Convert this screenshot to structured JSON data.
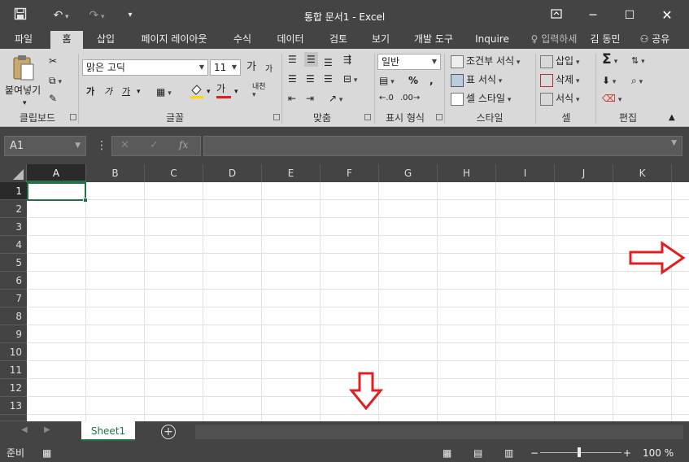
{
  "window": {
    "title": "통합 문서1 - Excel"
  },
  "ribbon_tabs": [
    "파일",
    "홈",
    "삽입",
    "페이지 레이아웃",
    "수식",
    "데이터",
    "검토",
    "보기",
    "개발 도구",
    "Inquire"
  ],
  "tell_me": "입력하세",
  "user": "김 동민",
  "share": "공유",
  "clipboard": {
    "paste": "붙여넣기",
    "label": "클립보드"
  },
  "font": {
    "name": "맑은 고딕",
    "size": "11",
    "grow": "가",
    "shrink": "가",
    "bold": "가",
    "italic": "가",
    "underline": "가",
    "color": "가",
    "phonetic": "내천",
    "label": "글꼴"
  },
  "alignment": {
    "label": "맞춤"
  },
  "number": {
    "format": "일반",
    "percent": "%",
    "comma": ",",
    "label": "표시 형식"
  },
  "styles": {
    "conditional": "조건부 서식",
    "table": "표 서식",
    "cell_style": "셀 스타일",
    "label": "스타일"
  },
  "cells": {
    "insert": "삽입",
    "delete": "삭제",
    "format": "서식",
    "label": "셀"
  },
  "editing": {
    "label": "편집"
  },
  "formula_bar": {
    "name_box": "A1",
    "fx": "fx"
  },
  "columns": [
    "A",
    "B",
    "C",
    "D",
    "E",
    "F",
    "G",
    "H",
    "I",
    "J",
    "K"
  ],
  "rows": [
    "1",
    "2",
    "3",
    "4",
    "5",
    "6",
    "7",
    "8",
    "9",
    "10",
    "11",
    "12",
    "13"
  ],
  "sheets": [
    "Sheet1"
  ],
  "status": {
    "ready": "준비",
    "zoom": "100 %"
  },
  "colors": {
    "excel_green": "#217346",
    "annotation_red": "#e02020"
  }
}
